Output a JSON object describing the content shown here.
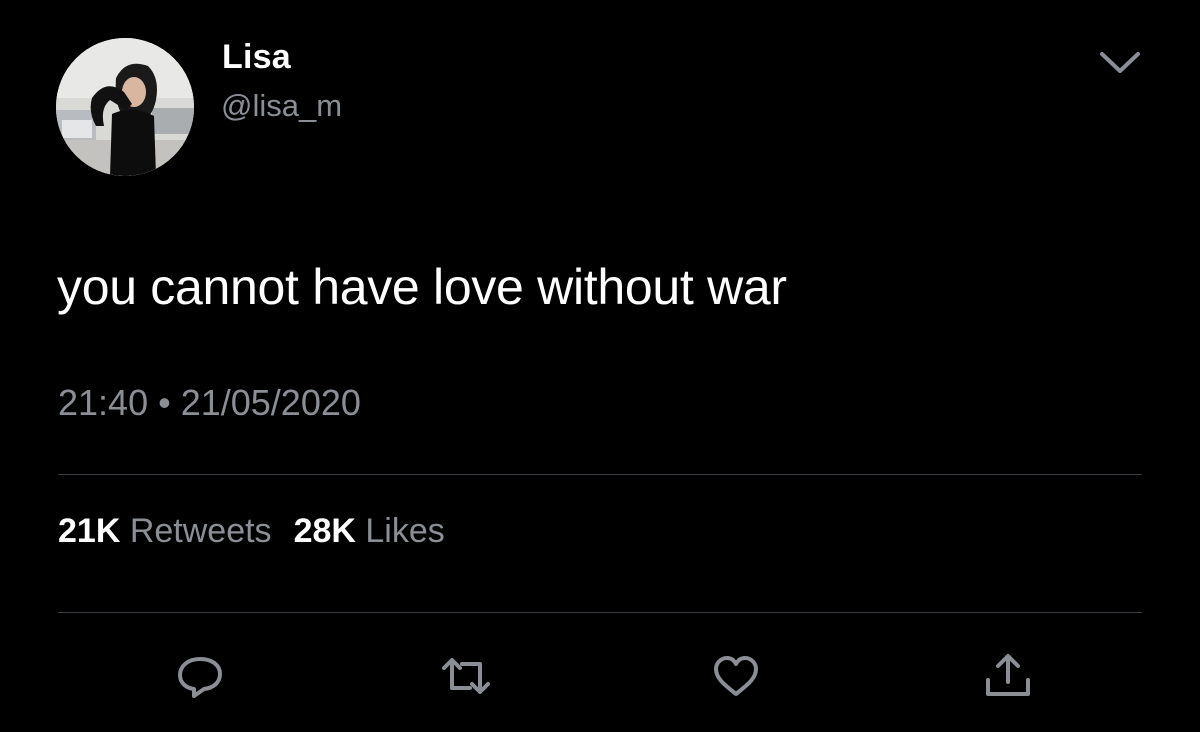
{
  "user": {
    "display_name": "Lisa",
    "handle": "@lisa_m"
  },
  "tweet": {
    "text": "you cannot have love without war",
    "time": "21:40",
    "separator": "•",
    "date": "21/05/2020"
  },
  "stats": {
    "retweets_count": "21K",
    "retweets_label": "Retweets",
    "likes_count": "28K",
    "likes_label": "Likes"
  },
  "icons": {
    "menu": "chevron-down-icon",
    "reply": "reply-icon",
    "retweet": "retweet-icon",
    "like": "heart-icon",
    "share": "share-icon"
  },
  "colors": {
    "background": "#000000",
    "primary_text": "#ffffff",
    "secondary_text": "#8b8f95",
    "divider": "#3a3d42",
    "icon": "#8b8f95"
  }
}
